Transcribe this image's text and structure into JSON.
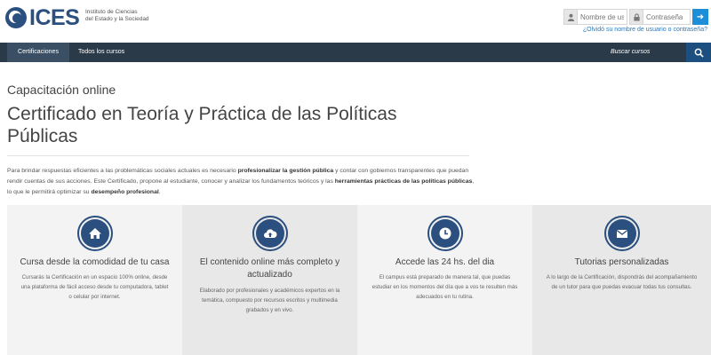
{
  "brand": {
    "name": "ICES",
    "subtitle_line1": "Instituto de Ciencias",
    "subtitle_line2": "del Estado y la Sociedad",
    "color": "#2b4f7e"
  },
  "login": {
    "username_placeholder": "Nombre de usuario",
    "password_placeholder": "Contraseña",
    "submit_icon": "arrow-right-icon",
    "forgot_link": "¿Olvidó su nombre de usuario o contraseña?"
  },
  "nav": {
    "items": [
      {
        "label": "Certificaciones ICES",
        "active": true
      },
      {
        "label": "Todos los cursos",
        "active": false
      }
    ],
    "search_label": "Buscar cursos",
    "search_icon": "search-icon",
    "bar_color": "#2b3a48",
    "search_button_color": "#1c4e80"
  },
  "page": {
    "subtitle": "Capacitación online",
    "title": "Certificado en Teoría y Práctica de las Políticas Públicas",
    "intro": {
      "p1": "Para brindar respuestas eficientes a las problemáticas sociales actuales es necesario ",
      "b1": "profesionalizar la gestión pública",
      "p2": " y contar con gobiernos transparentes que puedan rendir cuentas de sus acciones. Este Certificado, propone al estudiante, conocer y analizar los fundamentos teóricos y las ",
      "b2": "herramientas prácticas de las políticas públicas",
      "p3": ", lo que le permitirá optimizar su ",
      "b3": "desempeño profesional",
      "p4": "."
    }
  },
  "features": [
    {
      "icon": "home-icon",
      "title": "Cursa desde la comodidad de tu casa",
      "text": "Cursarás la Certificación en un espacio 100% online, desde una plataforma de fácil acceso desde tu computadora, tablet o celular por internet."
    },
    {
      "icon": "cloud-upload-icon",
      "title": "El contenido online más completo y actualizado",
      "text": "Elaborado por profesionales y académicos expertos en la temática, compuesto por recursos escritos y multimedia grabados y en vivo."
    },
    {
      "icon": "clock-icon",
      "title": "Accede las 24 hs. del dia",
      "text": "El campus está preparado de manera tal, que puedas estudiar en los momentos del día que a vos te resulten más adecuados en tu rutina."
    },
    {
      "icon": "envelope-icon",
      "title": "Tutorias personalizadas",
      "text": "A lo largo de la Certificación, dispondrás del acompañamiento de un tutor para que puedas evacuar todas tus consultas."
    }
  ]
}
